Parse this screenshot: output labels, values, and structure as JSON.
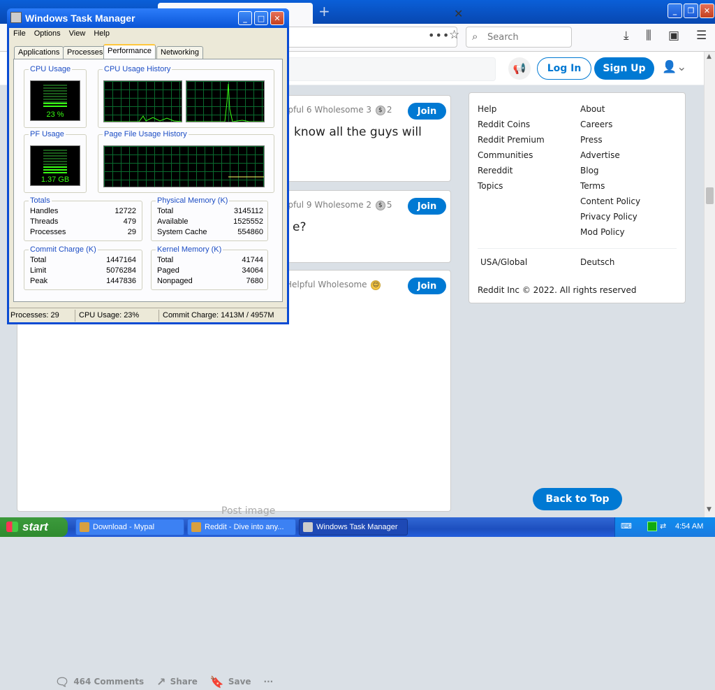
{
  "browser": {
    "search_placeholder": "Search",
    "reddit": {
      "login": "Log In",
      "signup": "Sign Up",
      "posts": [
        {
          "awards": "lpful 6  Wholesome 3",
          "award_count": "2",
          "title": "know all the guys will",
          "join": "Join"
        },
        {
          "awards": "lpful 9  Wholesome 2",
          "award_count": "5",
          "title": "e?",
          "join": "Join"
        },
        {
          "awards": "Helpful  Wholesome",
          "award_count": "",
          "title": "",
          "join": "Join"
        }
      ],
      "post_image_label": "Post image",
      "actions": {
        "comments": "464 Comments",
        "share": "Share",
        "save": "Save",
        "more": "···"
      },
      "sidebar": {
        "left": [
          "Help",
          "Reddit Coins",
          "Reddit Premium",
          "Communities",
          "Rereddit",
          "Topics"
        ],
        "right": [
          "About",
          "Careers",
          "Press",
          "Advertise",
          "Blog",
          "Terms",
          "Content Policy",
          "Privacy Policy",
          "Mod Policy"
        ],
        "lang_left": "USA/Global",
        "lang_right": "Deutsch",
        "copyright": "Reddit Inc © 2022. All rights reserved"
      },
      "back_to_top": "Back to Top"
    }
  },
  "task_manager": {
    "title": "Windows Task Manager",
    "menu": [
      "File",
      "Options",
      "View",
      "Help"
    ],
    "tabs": [
      "Applications",
      "Processes",
      "Performance",
      "Networking"
    ],
    "cpu_usage_label": "CPU Usage",
    "cpu_usage_value": "23 %",
    "cpu_usage_fraction": 0.23,
    "cpu_history_label": "CPU Usage History",
    "pf_usage_label": "PF Usage",
    "pf_usage_value": "1.37 GB",
    "pf_usage_fraction": 0.28,
    "pf_history_label": "Page File Usage History",
    "totals": {
      "label": "Totals",
      "rows": [
        [
          "Handles",
          "12722"
        ],
        [
          "Threads",
          "479"
        ],
        [
          "Processes",
          "29"
        ]
      ]
    },
    "physical_memory": {
      "label": "Physical Memory (K)",
      "rows": [
        [
          "Total",
          "3145112"
        ],
        [
          "Available",
          "1525552"
        ],
        [
          "System Cache",
          "554860"
        ]
      ]
    },
    "commit_charge": {
      "label": "Commit Charge (K)",
      "rows": [
        [
          "Total",
          "1447164"
        ],
        [
          "Limit",
          "5076284"
        ],
        [
          "Peak",
          "1447836"
        ]
      ]
    },
    "kernel_memory": {
      "label": "Kernel Memory (K)",
      "rows": [
        [
          "Total",
          "41744"
        ],
        [
          "Paged",
          "34064"
        ],
        [
          "Nonpaged",
          "7680"
        ]
      ]
    },
    "status": {
      "processes": "Processes: 29",
      "cpu": "CPU Usage: 23%",
      "commit": "Commit Charge: 1413M / 4957M"
    }
  },
  "taskbar": {
    "start": "start",
    "tasks": [
      "Download - Mypal",
      "Reddit - Dive into any...",
      "Windows Task Manager"
    ],
    "clock": "4:54 AM"
  }
}
